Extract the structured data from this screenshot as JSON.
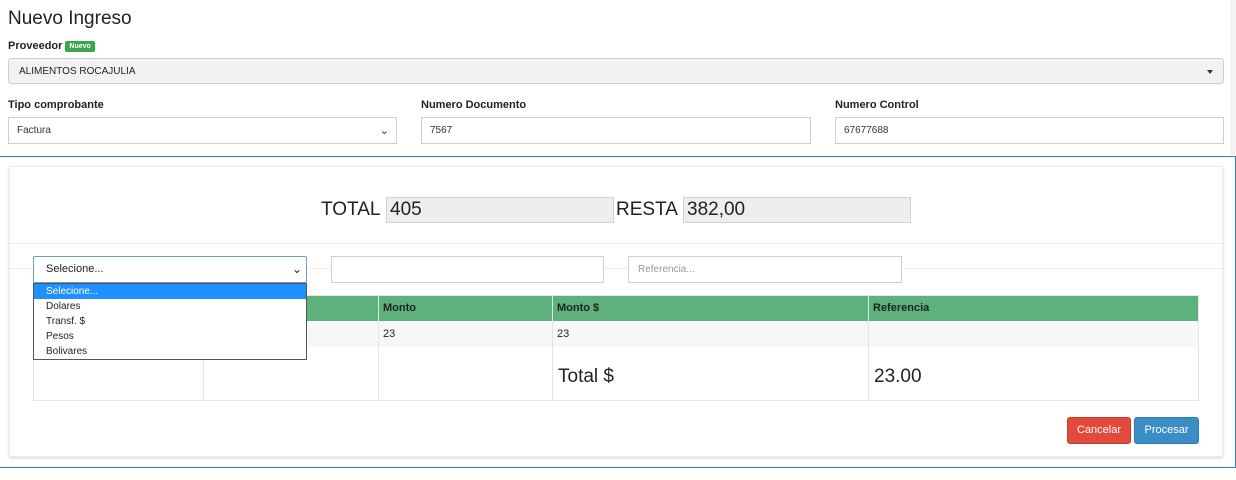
{
  "page": {
    "title": "Nuevo Ingreso"
  },
  "provider": {
    "label": "Proveedor",
    "badge": "Nuevo",
    "value": "ALIMENTOS ROCAJULIA"
  },
  "voucher_type": {
    "label": "Tipo comprobante",
    "value": "Factura"
  },
  "document_number": {
    "label": "Numero Documento",
    "value": "7567"
  },
  "control_number": {
    "label": "Numero Control",
    "value": "67677688"
  },
  "summary": {
    "total_label": "TOTAL",
    "total_value": "405",
    "remaining_label": "RESTA",
    "remaining_value": "382,00"
  },
  "payment": {
    "method_selected": "Selecione...",
    "amount_value": "",
    "reference_placeholder": "Referencia...",
    "options": [
      "Selecione...",
      "Dolares",
      "Transf. $",
      "Pesos",
      "Bolivares"
    ]
  },
  "table": {
    "columns": [
      "",
      "",
      "Monto",
      "Monto $",
      "Referencia"
    ],
    "rows": [
      [
        "",
        "",
        "23",
        "23",
        ""
      ]
    ],
    "footer": {
      "total_label": "Total $",
      "total_value": "23.00"
    }
  },
  "buttons": {
    "cancel": "Cancelar",
    "process": "Procesar"
  },
  "colors": {
    "badge": "#3ca64a",
    "table_header": "#5cb27a",
    "cancel": "#e24a3b",
    "process": "#3b8dc6",
    "selected_option": "#1e90ff"
  }
}
